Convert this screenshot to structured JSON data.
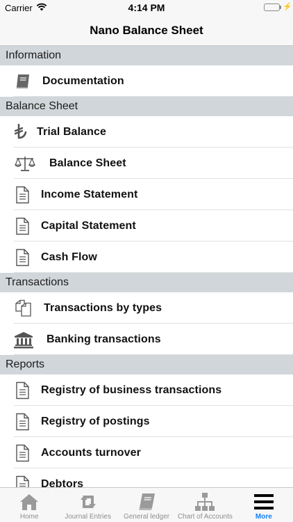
{
  "status_bar": {
    "carrier": "Carrier",
    "time": "4:14 PM",
    "battery_color": "#4cd964"
  },
  "nav": {
    "title": "Nano Balance Sheet"
  },
  "sections": [
    {
      "header": "Information",
      "rows": [
        {
          "label": "Documentation",
          "icon": "book-icon"
        }
      ]
    },
    {
      "header": "Balance Sheet",
      "rows": [
        {
          "label": "Trial Balance",
          "icon": "lira-icon"
        },
        {
          "label": "Balance Sheet",
          "icon": "scales-icon"
        },
        {
          "label": "Income Statement",
          "icon": "document-icon"
        },
        {
          "label": "Capital Statement",
          "icon": "document-icon"
        },
        {
          "label": "Cash Flow",
          "icon": "document-icon"
        }
      ]
    },
    {
      "header": "Transactions",
      "rows": [
        {
          "label": "Transactions by types",
          "icon": "copy-icon"
        },
        {
          "label": "Banking transactions",
          "icon": "bank-icon"
        }
      ]
    },
    {
      "header": "Reports",
      "rows": [
        {
          "label": "Registry of business transactions",
          "icon": "document-icon"
        },
        {
          "label": "Registry of postings",
          "icon": "document-icon"
        },
        {
          "label": "Accounts turnover",
          "icon": "document-icon"
        },
        {
          "label": "Debtors",
          "icon": "document-icon"
        }
      ]
    }
  ],
  "tabs": [
    {
      "label": "Home",
      "icon": "home-icon"
    },
    {
      "label": "Journal Entries",
      "icon": "retweet-icon"
    },
    {
      "label": "General ledger",
      "icon": "book-icon"
    },
    {
      "label": "Chart of Accounts",
      "icon": "sitemap-icon"
    },
    {
      "label": "More",
      "icon": "menu-icon",
      "active": true
    }
  ],
  "colors": {
    "accent": "#147efb",
    "section_header_bg": "#d1d6da",
    "bar_bg": "#f7f7f7"
  }
}
